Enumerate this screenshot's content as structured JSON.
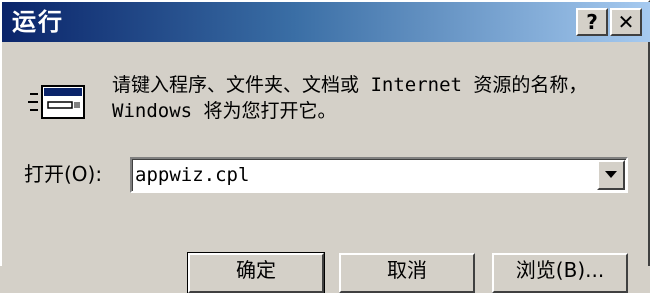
{
  "window": {
    "title": "运行",
    "help_label": "?",
    "close_label": "✕"
  },
  "icons": {
    "run": "run-dialog-icon"
  },
  "dialog": {
    "description": "请键入程序、文件夹、文档或 Internet 资源的名称，Windows 将为您打开它。",
    "open_label": "打开(O):",
    "open_value": "appwiz.cpl"
  },
  "buttons": {
    "ok": "确定",
    "cancel": "取消",
    "browse": "浏览(B)..."
  }
}
